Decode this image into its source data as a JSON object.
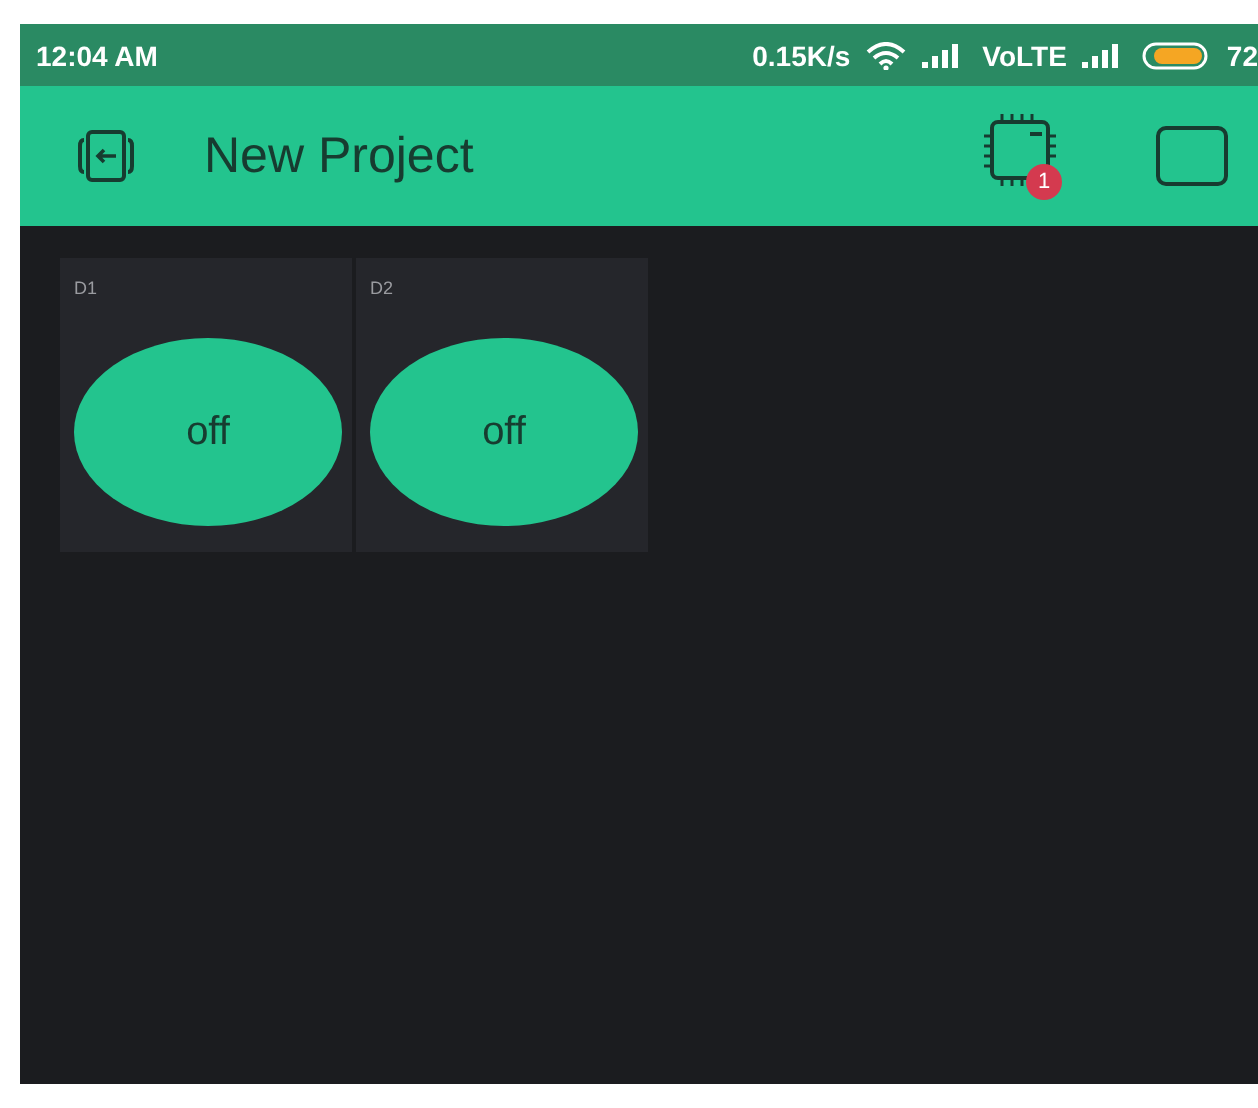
{
  "status_bar": {
    "time": "12:04 AM",
    "speed": "0.15K/s",
    "network": "VoLTE",
    "battery": "72"
  },
  "app_bar": {
    "title": "New Project",
    "device_badge": "1"
  },
  "widgets": [
    {
      "label": "D1",
      "text": "off",
      "on": false
    },
    {
      "label": "D2",
      "text": "off",
      "on": false
    }
  ]
}
